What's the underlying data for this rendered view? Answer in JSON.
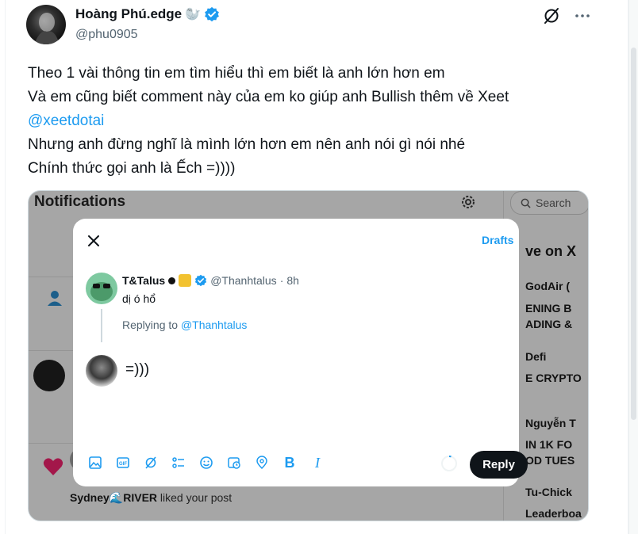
{
  "author": {
    "display_name": "Hoàng Phú.edge",
    "handle": "@phu0905"
  },
  "tweet": {
    "lines": [
      "Theo 1 vài thông tin em tìm hiểu thì em biết là anh lớn hơn em",
      "Và em cũng biết comment này của em ko giúp anh Bullish thêm về Xeet",
      "@xeetdotai",
      "Nhưng anh đừng nghĩ là mình lớn hơn em nên anh nói gì nói nhé",
      "Chính thức gọi anh là Ếch =))))"
    ]
  },
  "embed": {
    "notifications_title": "Notifications",
    "search_placeholder": "Search",
    "right_column": [
      "ve on X",
      "GodAir (",
      "ENING B",
      "ADING &",
      "Defi",
      "E CRYPTO",
      "Nguyễn T",
      "IN 1K FO",
      "OD TUES",
      "Tu-Chick",
      "Leaderboa"
    ],
    "liker_name": "Sydney🌊RIVER",
    "liker_action": "liked your post",
    "modal": {
      "drafts_label": "Drafts",
      "reply_to_name": "T&Talus",
      "reply_to_handle": "@Thanhtalus",
      "reply_to_time": "8h",
      "reply_to_text": "dị ó hổ",
      "replying_prefix": "Replying to",
      "replying_handle": "@Thanhtalus",
      "compose_text": "=)))",
      "reply_button": "Reply"
    }
  },
  "colors": {
    "accent": "#1d9bf0",
    "text": "#0f1419",
    "muted": "#536471"
  }
}
